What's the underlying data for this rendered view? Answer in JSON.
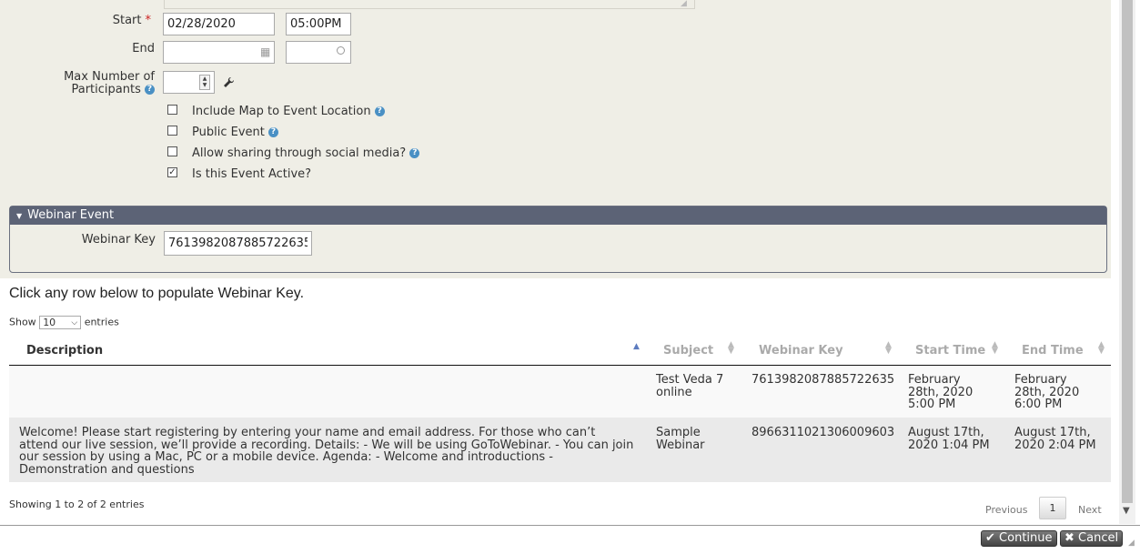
{
  "form": {
    "start_label": "Start",
    "required_mark": "*",
    "start_date": "02/28/2020",
    "start_time": "05:00PM",
    "end_label": "End",
    "end_date": "",
    "end_time": "",
    "max_participants_line1": "Max Number of",
    "max_participants_line2": "Participants",
    "max_participants_value": "",
    "help_glyph": "?",
    "checkboxes": [
      {
        "label": "Include Map to Event Location",
        "checked": false,
        "help": true
      },
      {
        "label": "Public Event",
        "checked": false,
        "help": true
      },
      {
        "label": "Allow sharing through social media?",
        "checked": false,
        "help": true
      },
      {
        "label": "Is this Event Active?",
        "checked": true,
        "help": false
      }
    ]
  },
  "webinar": {
    "section_title": "Webinar Event",
    "key_label": "Webinar Key",
    "key_value": "7613982087885722635"
  },
  "instructions": "Click any row below to populate Webinar Key.",
  "table_controls": {
    "show_label": "Show",
    "page_size": "10",
    "entries_label": "entries"
  },
  "table": {
    "columns": [
      "Description",
      "Subject",
      "Webinar Key",
      "Start Time",
      "End Time"
    ],
    "rows": [
      {
        "description": "",
        "subject": "Test Veda 7\nonline",
        "webinar_key": "7613982087885722635",
        "start_time": "February\n28th, 2020\n5:00 PM",
        "end_time": "February\n28th, 2020\n6:00 PM"
      },
      {
        "description": "Welcome! Please start registering by entering your name and email address. For those who can’t attend our live session, we’ll provide a recording. Details: - We will be using GoToWebinar. - You can join our session by using a Mac, PC or a mobile device. Agenda: - Welcome and introductions - Demonstration and questions",
        "subject": "Sample\nWebinar",
        "webinar_key": "8966311021306009603",
        "start_time": "August 17th,\n2020 1:04 PM",
        "end_time": "August 17th,\n2020 2:04 PM"
      }
    ]
  },
  "pagination": {
    "info": "Showing 1 to 2 of 2 entries",
    "previous": "Previous",
    "current_page": "1",
    "next": "Next"
  },
  "dialog_buttons": {
    "continue": "Continue",
    "cancel": "Cancel"
  },
  "colors": {
    "form_bg": "#efeee6",
    "section_header": "#5c6376",
    "help_icon": "#4a90c4",
    "required": "#cc2222"
  }
}
